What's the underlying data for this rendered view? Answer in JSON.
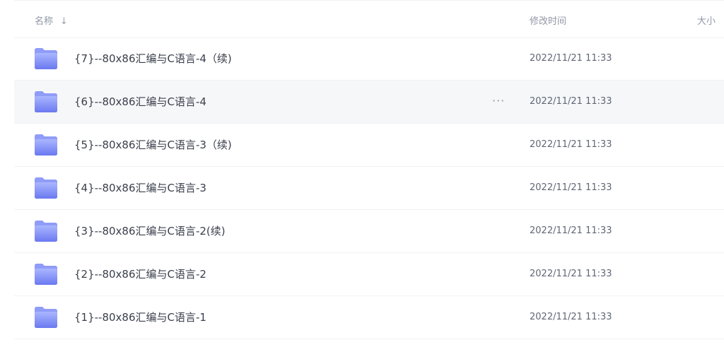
{
  "header": {
    "name_label": "名称",
    "sort_icon": "arrow-down-icon",
    "time_label": "修改时间",
    "size_label": "大小"
  },
  "rows": [
    {
      "name": "{7}--80x86汇编与C语言-4（续)",
      "time": "2022/11/21 11:33",
      "icon": "folder-icon"
    },
    {
      "name": "{6}--80x86汇编与C语言-4",
      "time": "2022/11/21 11:33",
      "icon": "folder-icon",
      "more_label": "···"
    },
    {
      "name": "{5}--80x86汇编与C语言-3（续)",
      "time": "2022/11/21 11:33",
      "icon": "folder-icon"
    },
    {
      "name": "{4}--80x86汇编与C语言-3",
      "time": "2022/11/21 11:33",
      "icon": "folder-icon"
    },
    {
      "name": "{3}--80x86汇编与C语言-2(续)",
      "time": "2022/11/21 11:33",
      "icon": "folder-icon"
    },
    {
      "name": "{2}--80x86汇编与C语言-2",
      "time": "2022/11/21 11:33",
      "icon": "folder-icon"
    },
    {
      "name": "{1}--80x86汇编与C语言-1",
      "time": "2022/11/21 11:33",
      "icon": "folder-icon"
    }
  ],
  "colors": {
    "folder_top": "#a3b0ff",
    "folder_bottom": "#6c7cf2",
    "hover_bg": "#f6f7f9"
  }
}
